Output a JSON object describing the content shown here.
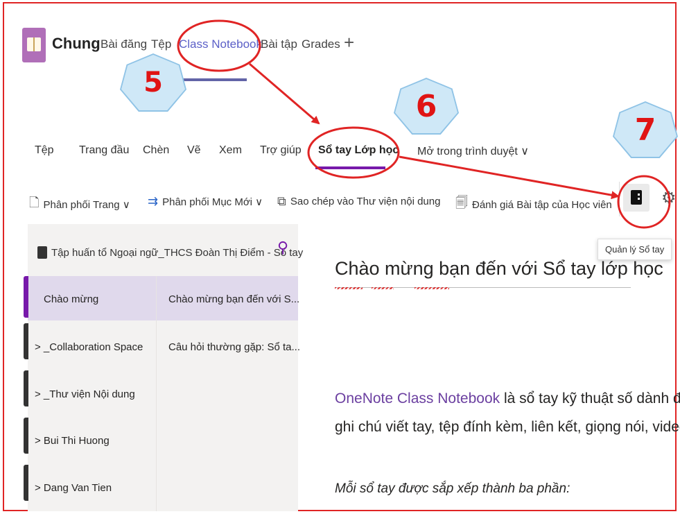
{
  "header": {
    "team_name": "Chung",
    "tabs": [
      "Bài đăng",
      "Tệp",
      "Class Notebook",
      "Bài tập",
      "Grades"
    ],
    "add_tab": "+"
  },
  "ribbon": {
    "tabs": [
      "Tệp",
      "Trang đầu",
      "Chèn",
      "Vẽ",
      "Xem",
      "Trợ giúp",
      "Sổ tay Lớp học",
      "Mở trong trình duyệt ∨"
    ],
    "commands": [
      {
        "label": "Phân phối Trang ∨",
        "icon": "page-icon"
      },
      {
        "label": "Phân phối Mục Mới ∨",
        "icon": "arrow-right-icon"
      },
      {
        "label": "Sao chép vào Thư viện nội dung",
        "icon": "copy-icon"
      },
      {
        "label": "Đánh giá Bài tập của Học viên",
        "icon": "review-icon"
      }
    ],
    "tooltip": "Quản lý Sổ tay"
  },
  "navigation": {
    "notebook_title": "Tập huấn tổ Ngoại ngữ_THCS Đoàn Thị Điểm - Sổ tay",
    "sections": [
      "Chào mừng",
      "> _Collaboration Space",
      "> _Thư viện Nội dung",
      "> Bui Thi Huong",
      "> Dang Van Tien"
    ],
    "pages": [
      "Chào mừng bạn đến với S...",
      "Câu hỏi thường gặp: Sổ ta..."
    ]
  },
  "content": {
    "title": "Chào mừng bạn đến với Sổ tay lớp học",
    "link": "OneNote Class Notebook",
    "para1_rest": " là sổ tay kỹ thuật số dành để",
    "para2": "ghi chú viết tay, tệp đính kèm, liên kết, giọng nói, video,",
    "italic": "Mỗi sổ tay được sắp xếp thành ba phần:"
  },
  "annotations": {
    "step5": "5",
    "step6": "6",
    "step7": "7"
  },
  "colors": {
    "annotation_red": "#e02424",
    "accent_purple": "#7719aa",
    "teams_purple": "#6264a7",
    "badge_fill": "#cfe8f7"
  }
}
